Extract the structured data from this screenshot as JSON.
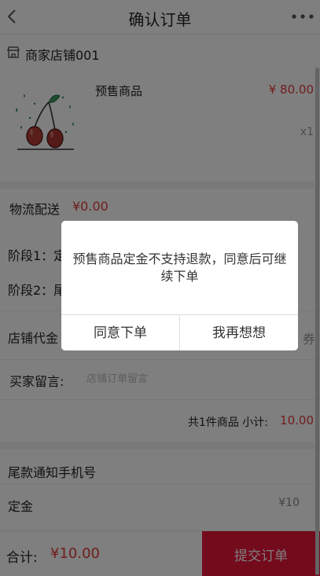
{
  "header": {
    "title": "确认订单"
  },
  "shop": {
    "name": "商家店铺001"
  },
  "product": {
    "name": "预售商品",
    "price": "¥ 80.00",
    "quantity": "x1"
  },
  "shipping": {
    "label": "物流配送",
    "value": "¥0.00"
  },
  "stages": {
    "stage1": "阶段1：定",
    "stage2": "阶段2：尾"
  },
  "coupon": {
    "label": "店铺代金",
    "action": "券"
  },
  "message": {
    "label": "买家留言:",
    "placeholder": "店铺订单留言"
  },
  "subtotal": {
    "text": "共1件商品 小计:",
    "value": "10.00"
  },
  "phone": {
    "label": "尾款通知手机号"
  },
  "deposit": {
    "label": "定金",
    "value": "¥10"
  },
  "footer": {
    "total_label": "合计:",
    "total_value": "¥10.00",
    "submit_label": "提交订单"
  },
  "modal": {
    "message": "预售商品定金不支持退款，同意后可继续下单",
    "confirm_label": "同意下单",
    "cancel_label": "我再想想"
  },
  "colors": {
    "accent": "#e8163a",
    "price": "#e23b3b",
    "overlay": "rgba(0,0,0,0.5)"
  },
  "icons": [
    "back-icon",
    "more-icon",
    "shop-icon",
    "cherry-image"
  ]
}
